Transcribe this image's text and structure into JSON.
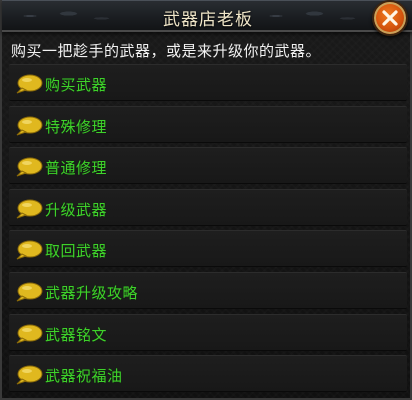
{
  "dialog": {
    "title": "武器店老板",
    "close_icon": "close-x-icon",
    "prompt": "购买一把趁手的武器，或是来升级你的武器。"
  },
  "menu": {
    "icon": "speech-bubble-icon",
    "icon_color": "#e0b81f",
    "label_color": "#3fd12b",
    "items": [
      {
        "label": "购买武器"
      },
      {
        "label": "特殊修理"
      },
      {
        "label": "普通修理"
      },
      {
        "label": "升级武器"
      },
      {
        "label": "取回武器"
      },
      {
        "label": "武器升级攻略"
      },
      {
        "label": "武器铭文"
      },
      {
        "label": "武器祝福油"
      }
    ]
  }
}
